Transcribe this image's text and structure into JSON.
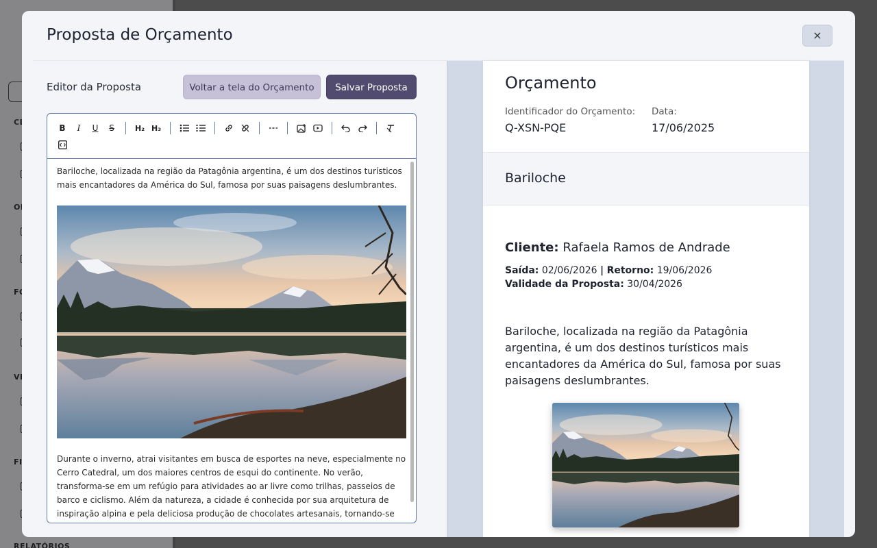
{
  "background": {
    "sections": [
      "CL",
      "OF",
      "FO",
      "VE",
      "FIN",
      "RELATÓRIOS"
    ]
  },
  "modal": {
    "title": "Proposta de Orçamento",
    "close_label": "×"
  },
  "editor": {
    "heading": "Editor da Proposta",
    "back_button": "Voltar a tela do Orçamento",
    "save_button": "Salvar Proposta",
    "toolbar": {
      "bold": "B",
      "italic": "I",
      "underline": "U",
      "strike": "S",
      "h2": "H₂",
      "h3": "H₃"
    },
    "paragraph1": "Bariloche, localizada na região da Patagônia argentina, é um dos destinos turísticos mais encantadores da América do Sul, famosa por suas paisagens deslumbrantes.",
    "paragraph2": "Durante o inverno, atrai visitantes em busca de esportes na neve, especialmente no Cerro Catedral, um dos maiores centros de esqui do continente. No verão, transforma-se em um refúgio para atividades ao ar livre como trilhas, passeios de barco e ciclismo. Além da natureza, a cidade é conhecida por sua arquitetura de inspiração alpina e pela deliciosa produção de chocolates artesanais, tornando-se um destino completo para quem busca beleza"
  },
  "preview": {
    "title": "Orçamento",
    "id_label": "Identificador do Orçamento:",
    "id_value": "Q-XSN-PQE",
    "date_label": "Data:",
    "date_value": "17/06/2025",
    "destination": "Bariloche",
    "client_label": "Cliente:",
    "client_name": "Rafaela Ramos de Andrade",
    "departure_label": "Saída:",
    "departure_value": "02/06/2026",
    "separator": "|",
    "return_label": "Retorno:",
    "return_value": "19/06/2026",
    "validity_label": "Validade da Proposta:",
    "validity_value": "30/04/2026",
    "description": "Bariloche, localizada na região da Patagônia argentina, é um dos destinos turísticos mais encantadores da América do Sul, famosa por suas paisagens deslumbrantes."
  }
}
